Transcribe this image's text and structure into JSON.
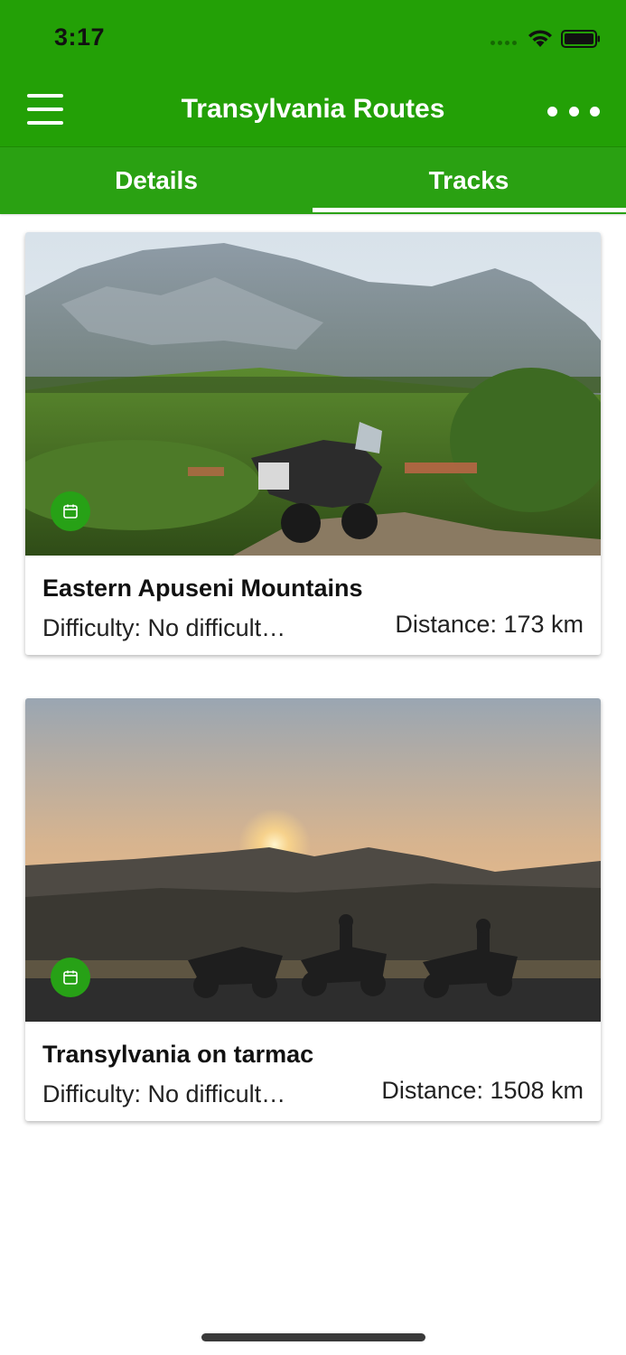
{
  "status_bar": {
    "time": "3:17"
  },
  "app_bar": {
    "title": "Transylvania Routes",
    "menu_icon": "hamburger-menu-icon",
    "more_icon": "more-dots-icon"
  },
  "tabs": [
    {
      "label": "Details",
      "selected": false
    },
    {
      "label": "Tracks",
      "selected": true
    }
  ],
  "tracks": [
    {
      "title": "Eastern Apuseni Mountains",
      "difficulty": "Difficulty: No difficult…",
      "distance": "Distance: 173 km",
      "badge_icon": "calendar-icon",
      "image": "mountain-motorcycle-photo"
    },
    {
      "title": "Transylvania on tarmac",
      "difficulty": "Difficulty: No difficult…",
      "distance": "Distance: 1508 km",
      "badge_icon": "calendar-icon",
      "image": "sunset-motorcycles-photo"
    }
  ],
  "colors": {
    "primary": "#23a006",
    "tab_bar": "#2aa112",
    "badge": "#27a116"
  }
}
